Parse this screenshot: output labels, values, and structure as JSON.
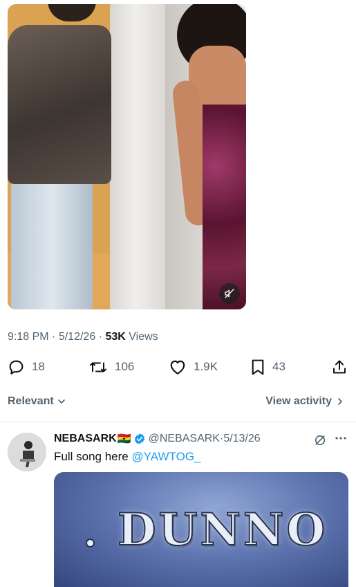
{
  "tweet": {
    "time": "9:18 PM",
    "date": "5/12/26",
    "views_count": "53K",
    "views_label": "Views",
    "replies": "18",
    "reposts": "106",
    "likes": "1.9K",
    "bookmarks": "43"
  },
  "replies_bar": {
    "sort_label": "Relevant",
    "view_activity_label": "View activity"
  },
  "reply": {
    "author_name": "NEBASARK",
    "flag": "🇬🇭",
    "handle": "@NEBASARK",
    "date": "5/13/26",
    "text": "Full song here",
    "mention": "@YAWTOG_",
    "media_title": "DUNNO"
  },
  "colors": {
    "accent": "#1d9bf0",
    "muted": "#536471",
    "text": "#0f1419"
  },
  "icons": [
    "mute-icon",
    "reply-icon",
    "repost-icon",
    "like-icon",
    "bookmark-icon",
    "share-icon",
    "chevron-down-icon",
    "chevron-right-icon",
    "verified-icon",
    "grok-icon",
    "more-icon"
  ]
}
